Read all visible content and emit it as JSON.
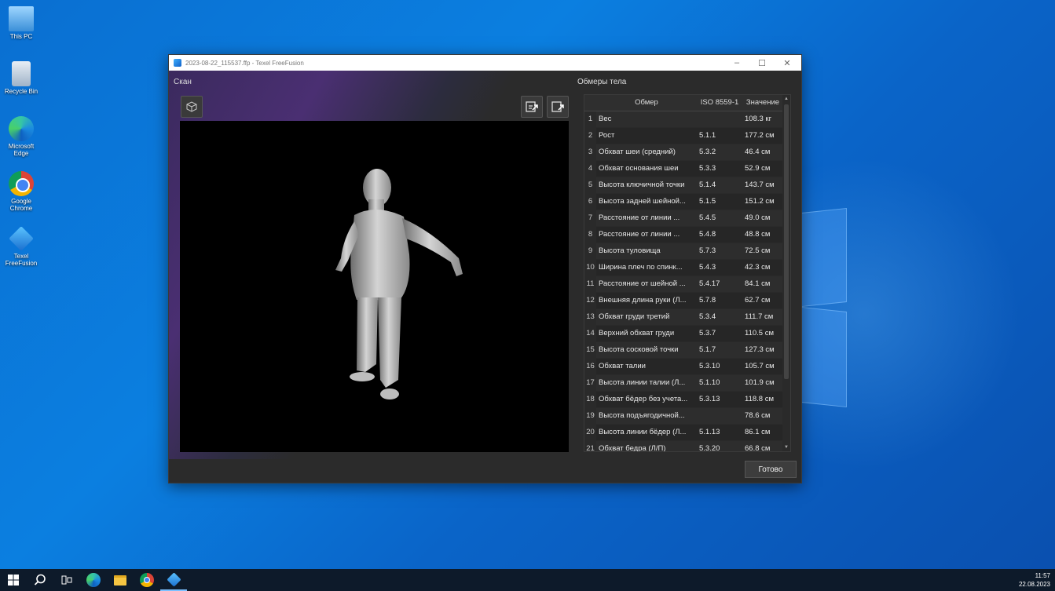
{
  "desktop": {
    "icons": [
      {
        "label": "This PC"
      },
      {
        "label": "Recycle Bin"
      },
      {
        "label": "Microsoft Edge"
      },
      {
        "label": "Google Chrome"
      },
      {
        "label": "Texel FreeFusion"
      }
    ]
  },
  "window": {
    "title": "2023-08-22_115537.ffp - Texel FreeFusion",
    "minimize": "–",
    "maximize": "☐",
    "close": "✕"
  },
  "scan": {
    "label": "Скан"
  },
  "measurements": {
    "label": "Обмеры тела",
    "headers": {
      "measure": "Обмер",
      "iso": "ISO 8559-1",
      "value": "Значение"
    },
    "rows": [
      {
        "n": "1",
        "name": "Вес",
        "iso": "",
        "value": "108.3 кг"
      },
      {
        "n": "2",
        "name": "Рост",
        "iso": "5.1.1",
        "value": "177.2 см"
      },
      {
        "n": "3",
        "name": "Обхват шеи (средний)",
        "iso": "5.3.2",
        "value": "46.4 см"
      },
      {
        "n": "4",
        "name": "Обхват основания шеи",
        "iso": "5.3.3",
        "value": "52.9 см"
      },
      {
        "n": "5",
        "name": "Высота ключичной точки",
        "iso": "5.1.4",
        "value": "143.7 см"
      },
      {
        "n": "6",
        "name": "Высота задней шейной...",
        "iso": "5.1.5",
        "value": "151.2 см"
      },
      {
        "n": "7",
        "name": "Расстояние от линии ...",
        "iso": "5.4.5",
        "value": "49.0 см"
      },
      {
        "n": "8",
        "name": "Расстояние от линии ...",
        "iso": "5.4.8",
        "value": "48.8 см"
      },
      {
        "n": "9",
        "name": "Высота туловища",
        "iso": "5.7.3",
        "value": "72.5 см"
      },
      {
        "n": "10",
        "name": "Ширина плеч по спинк...",
        "iso": "5.4.3",
        "value": "42.3 см"
      },
      {
        "n": "11",
        "name": "Расстояние от шейной ...",
        "iso": "5.4.17",
        "value": "84.1 см"
      },
      {
        "n": "12",
        "name": "Внешняя длина руки (Л...",
        "iso": "5.7.8",
        "value": "62.7 см"
      },
      {
        "n": "13",
        "name": "Обхват груди третий",
        "iso": "5.3.4",
        "value": "111.7 см"
      },
      {
        "n": "14",
        "name": "Верхний обхват груди",
        "iso": "5.3.7",
        "value": "110.5 см"
      },
      {
        "n": "15",
        "name": "Высота сосковой точки",
        "iso": "5.1.7",
        "value": "127.3 см"
      },
      {
        "n": "16",
        "name": "Обхват талии",
        "iso": "5.3.10",
        "value": "105.7 см"
      },
      {
        "n": "17",
        "name": "Высота линии талии (Л...",
        "iso": "5.1.10",
        "value": "101.9 см"
      },
      {
        "n": "18",
        "name": "Обхват бёдер без учета...",
        "iso": "5.3.13",
        "value": "118.8 см"
      },
      {
        "n": "19",
        "name": "Высота подъягодичной...",
        "iso": "",
        "value": "78.6 см"
      },
      {
        "n": "20",
        "name": "Высота линии бёдер (Л...",
        "iso": "5.1.13",
        "value": "86.1 см"
      },
      {
        "n": "21",
        "name": "Обхват бедра (Л/П)",
        "iso": "5.3.20",
        "value": "66.8 см"
      }
    ]
  },
  "done_button": "Готово",
  "taskbar": {
    "time": "11:57",
    "date": "22.08.2023"
  }
}
